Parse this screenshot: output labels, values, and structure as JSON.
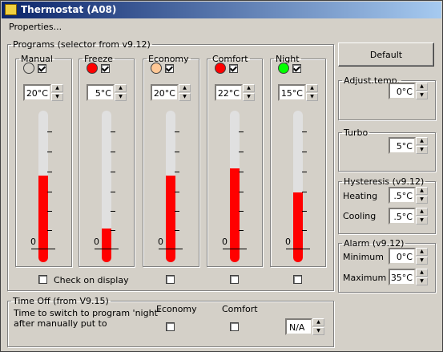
{
  "window": {
    "title": "Thermostat (A08)"
  },
  "properties_label": "Properties...",
  "programs_label": "Programs (selector from v9.12)",
  "scale_zero": "0",
  "programs": [
    {
      "name": "Manual",
      "led_color": "#d4d0c8",
      "enabled": true,
      "temp": "20°C",
      "fill": 0.57
    },
    {
      "name": "Freeze",
      "led_color": "#ff0000",
      "enabled": true,
      "temp": "5°C",
      "fill": 0.22
    },
    {
      "name": "Economy",
      "led_color": "#ffc896",
      "enabled": true,
      "temp": "20°C",
      "fill": 0.57
    },
    {
      "name": "Comfort",
      "led_color": "#ff0000",
      "enabled": true,
      "temp": "22°C",
      "fill": 0.62
    },
    {
      "name": "Night",
      "led_color": "#00ff00",
      "enabled": true,
      "temp": "15°C",
      "fill": 0.46
    }
  ],
  "check_on_display_label": "Check on display",
  "default_button": "Default",
  "adjust": {
    "label": "Adjust.temp.",
    "value": "0°C"
  },
  "turbo": {
    "label": "Turbo",
    "value": "5°C"
  },
  "hysteresis": {
    "label": "Hysteresis (v9.12)",
    "heating_label": "Heating",
    "heating_value": ".5°C",
    "cooling_label": "Cooling",
    "cooling_value": ".5°C"
  },
  "alarm": {
    "label": "Alarm (v9.12)",
    "min_label": "Minimum",
    "min_value": "0°C",
    "max_label": "Maximum",
    "max_value": "35°C"
  },
  "timeoff": {
    "label": "Time Off (from V9.15)",
    "desc1": "Time to switch to program 'night'",
    "desc2": "after manually put to",
    "economy_label": "Economy",
    "comfort_label": "Comfort",
    "value": "N/A"
  }
}
